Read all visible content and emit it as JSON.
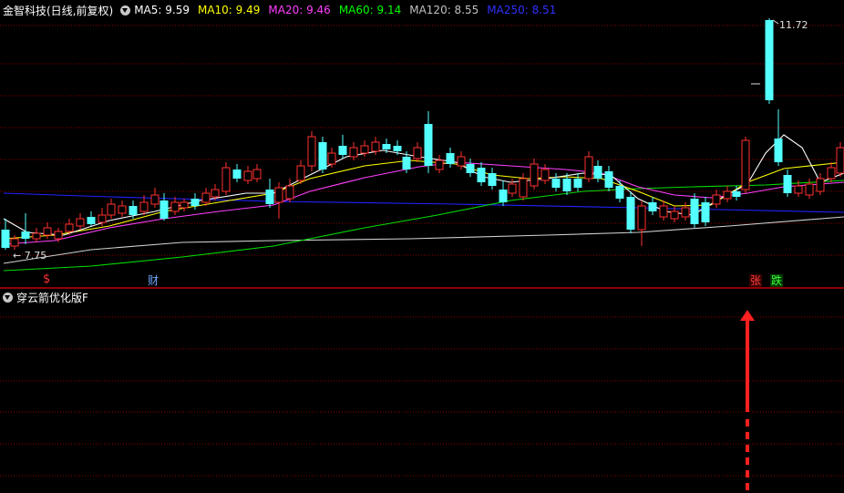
{
  "header": {
    "stock_title": "金智科技(日线,前复权)",
    "ma_legend": [
      {
        "label": "MA5: 9.59",
        "color": "#ffffff"
      },
      {
        "label": "MA10: 9.49",
        "color": "#ffff00"
      },
      {
        "label": "MA20: 9.46",
        "color": "#ff40ff"
      },
      {
        "label": "MA60: 9.14",
        "color": "#00ff00"
      },
      {
        "label": "MA120: 8.55",
        "color": "#c0c0c0"
      },
      {
        "label": "MA250: 8.51",
        "color": "#3030ff"
      }
    ]
  },
  "price_labels": {
    "high": "11.72",
    "low": "7.75"
  },
  "markers": {
    "dollar": "$",
    "cai": "财",
    "zhang": "张",
    "die": "跌"
  },
  "indicator_panel": {
    "title": "穿云箭优化版F"
  },
  "colors": {
    "background": "#000000",
    "grid": "#8b0000",
    "up_candle": "#ff3030",
    "down_candle": "#54ffff",
    "arrow": "#ff2020"
  },
  "chart_data": {
    "type": "candlestick",
    "price_high": 11.72,
    "price_low": 7.75,
    "ma_values": {
      "MA5": 9.59,
      "MA10": 9.49,
      "MA20": 9.46,
      "MA60": 9.14,
      "MA120": 8.55,
      "MA250": 8.51
    }
  }
}
